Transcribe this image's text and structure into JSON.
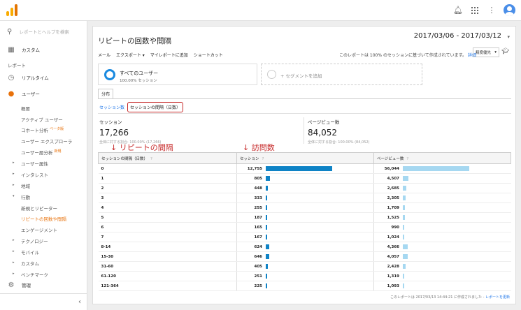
{
  "topbar": {
    "icons": [
      "bell-icon",
      "apps-icon",
      "more-icon",
      "account-icon"
    ]
  },
  "sidebar": {
    "search_placeholder": "レポートとヘルプを検索",
    "custom": "カスタム",
    "reports_section": "レポート",
    "realtime": "リアルタイム",
    "users": "ユーザー",
    "subitems": [
      "概要",
      "アクティブ ユーザー",
      "コホート分析",
      "ユーザー エクスプローラ",
      "ユーザー層分析"
    ],
    "beta": "ベータ版",
    "new": "新規",
    "groups": [
      "ユーザー属性",
      "インタレスト",
      "地域"
    ],
    "behavior": "行動",
    "behavior_subitems": [
      "新規とリピーター",
      "リピートの回数や間隔",
      "エンゲージメント"
    ],
    "groups2": [
      "テクノロジー",
      "モバイル",
      "カスタム",
      "ベンチマーク"
    ],
    "admin": "管理"
  },
  "main": {
    "title": "リピートの回数や間隔",
    "daterange": "2017/03/06 - 2017/03/12",
    "toolbar": [
      "メール",
      "エクスポート ▾",
      "マイレポートに追加",
      "ショートカット"
    ],
    "notice": "このレポートは 100% のセッションに基づいて作成されています。",
    "notice_link": "詳細",
    "select": "精度優先",
    "segment_name": "すべてのユーザー",
    "segment_sub": "100.00% セッション",
    "add_segment": "+ セグメントを追加",
    "tab": "分布",
    "sublink_sessions": "セッション数",
    "sublink_interval": "セッションの間隔（日数）",
    "metric_sessions_label": "セッション",
    "metric_sessions_value": "17,266",
    "metric_sessions_sub": "全体に対する割合: 100.00% (17,266)",
    "metric_pv_label": "ページビュー数",
    "metric_pv_value": "84,052",
    "metric_pv_sub": "全体に対する割合: 100.00% (84,052)",
    "annot_left": "↓ リピートの間隔",
    "annot_right": "↓ 訪問数",
    "col1": "セッションの間隔（日数）",
    "col2": "セッション",
    "col3": "ページビュー数",
    "footer": "このレポートは 2017/03/13 14:44:21 に作成されました -",
    "footer_link": "レポートを更新"
  },
  "table_rows": [
    {
      "interval": "0",
      "sessions": "12,755",
      "s": 12755,
      "pageviews": "56,044",
      "p": 56044
    },
    {
      "interval": "1",
      "sessions": "805",
      "s": 805,
      "pageviews": "4,507",
      "p": 4507
    },
    {
      "interval": "2",
      "sessions": "448",
      "s": 448,
      "pageviews": "2,685",
      "p": 2685
    },
    {
      "interval": "3",
      "sessions": "333",
      "s": 333,
      "pageviews": "2,305",
      "p": 2305
    },
    {
      "interval": "4",
      "sessions": "255",
      "s": 255,
      "pageviews": "1,709",
      "p": 1709
    },
    {
      "interval": "5",
      "sessions": "187",
      "s": 187,
      "pageviews": "1,525",
      "p": 1525
    },
    {
      "interval": "6",
      "sessions": "165",
      "s": 165,
      "pageviews": "990",
      "p": 990
    },
    {
      "interval": "7",
      "sessions": "167",
      "s": 167,
      "pageviews": "1,024",
      "p": 1024
    },
    {
      "interval": "8-14",
      "sessions": "624",
      "s": 624,
      "pageviews": "4,366",
      "p": 4366
    },
    {
      "interval": "15-30",
      "sessions": "646",
      "s": 646,
      "pageviews": "4,057",
      "p": 4057
    },
    {
      "interval": "31-60",
      "sessions": "405",
      "s": 405,
      "pageviews": "2,428",
      "p": 2428
    },
    {
      "interval": "61-120",
      "sessions": "251",
      "s": 251,
      "pageviews": "1,319",
      "p": 1319
    },
    {
      "interval": "121-364",
      "sessions": "225",
      "s": 225,
      "pageviews": "1,093",
      "p": 1093
    }
  ],
  "colors": {
    "session_bar": "#0f83c6",
    "pageview_bar": "#a6d8f1",
    "accent": "#e8710a",
    "highlight": "#c62828"
  }
}
